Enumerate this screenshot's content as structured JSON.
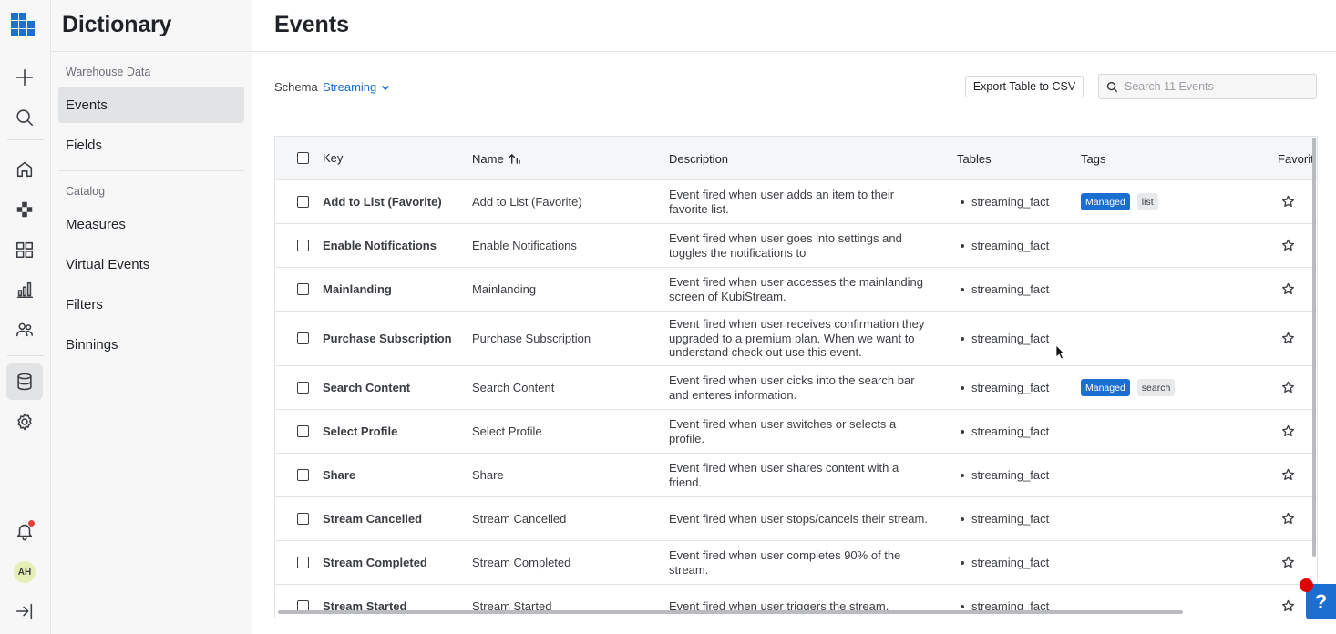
{
  "rail": {
    "icons": [
      "app-grid-logo",
      "plus-icon",
      "search-icon",
      "home-icon",
      "integrations-icon",
      "dashboard-icon",
      "chart-icon",
      "people-icon",
      "database-icon",
      "gear-icon",
      "bell-icon",
      "collapse-icon"
    ],
    "avatar_initials": "AH"
  },
  "sidebar": {
    "title": "Dictionary",
    "groups": [
      {
        "label": "Warehouse Data",
        "items": [
          {
            "label": "Events",
            "active": true
          },
          {
            "label": "Fields",
            "active": false
          }
        ]
      },
      {
        "label": "Catalog",
        "items": [
          {
            "label": "Measures"
          },
          {
            "label": "Virtual Events"
          },
          {
            "label": "Filters"
          },
          {
            "label": "Binnings"
          }
        ]
      }
    ]
  },
  "main": {
    "title": "Events",
    "schema_label": "Schema",
    "schema_value": "Streaming",
    "export_label": "Export Table to CSV",
    "search_placeholder": "Search 11 Events"
  },
  "table": {
    "columns": {
      "key": "Key",
      "name": "Name",
      "description": "Description",
      "tables": "Tables",
      "tags": "Tags",
      "favorite": "Favorit"
    },
    "rows": [
      {
        "key": "Add to List (Favorite)",
        "name": "Add to List (Favorite)",
        "description": "Event fired when user adds an item to their favorite list.",
        "table": "streaming_fact",
        "tags": [
          "Managed",
          "list"
        ]
      },
      {
        "key": "Enable Notifications",
        "name": "Enable Notifications",
        "description": "Event fired when user goes into settings and toggles the notifications to",
        "table": "streaming_fact",
        "tags": []
      },
      {
        "key": "Mainlanding",
        "name": "Mainlanding",
        "description": "Event fired when user accesses the mainlanding screen of KubiStream.",
        "table": "streaming_fact",
        "tags": []
      },
      {
        "key": "Purchase Subscription",
        "name": "Purchase Subscription",
        "description": "Event fired when user receives confirmation they upgraded to a premium plan. When we want to understand check out use this event.",
        "table": "streaming_fact",
        "tags": []
      },
      {
        "key": "Search Content",
        "name": "Search Content",
        "description": "Event fired when user cicks into the search bar and enteres information.",
        "table": "streaming_fact",
        "tags": [
          "Managed",
          "search"
        ]
      },
      {
        "key": "Select Profile",
        "name": "Select Profile",
        "description": "Event fired when user switches or selects a profile.",
        "table": "streaming_fact",
        "tags": []
      },
      {
        "key": "Share",
        "name": "Share",
        "description": "Event fired when user shares content with a friend.",
        "table": "streaming_fact",
        "tags": []
      },
      {
        "key": "Stream Cancelled",
        "name": "Stream Cancelled",
        "description": "Event fired when user stops/cancels their stream.",
        "table": "streaming_fact",
        "tags": []
      },
      {
        "key": "Stream Completed",
        "name": "Stream Completed",
        "description": "Event fired when user completes 90% of the stream.",
        "table": "streaming_fact",
        "tags": []
      },
      {
        "key": "Stream Started",
        "name": "Stream Started",
        "description": "Event fired when user triggers the stream.",
        "table": "streaming_fact",
        "tags": []
      }
    ]
  },
  "help": {
    "label": "?"
  },
  "colors": {
    "accent": "#1a6fd0",
    "managed_tag": "#1a6fd0",
    "notification_dot": "#e5413a"
  }
}
